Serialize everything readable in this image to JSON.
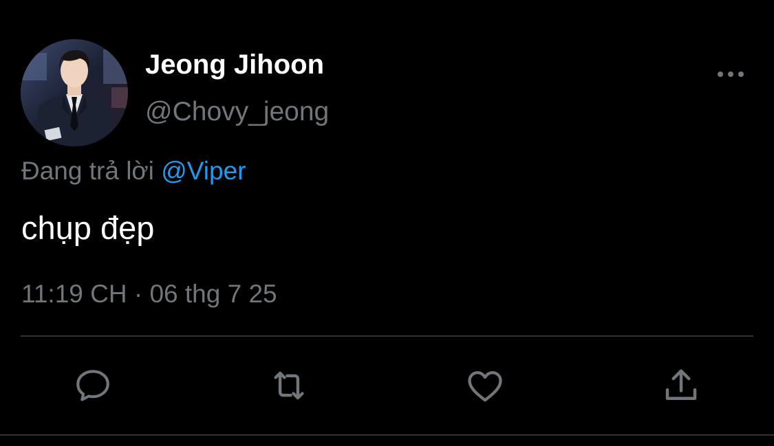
{
  "tweet": {
    "author": {
      "display_name": "Jeong Jihoon",
      "handle": "@Chovy_jeong"
    },
    "reply_context": {
      "prefix": "Đang trả lời",
      "mention": "@Viper"
    },
    "text": "chụp đẹp",
    "timestamp": "11:19 CH · 06 thg 7 25"
  },
  "icons": {
    "more": "more-horizontal-icon",
    "reply": "reply-icon",
    "retweet": "retweet-icon",
    "like": "heart-icon",
    "share": "share-icon"
  },
  "colors": {
    "background": "#000000",
    "primary_text": "#ffffff",
    "secondary_text": "#71767b",
    "link": "#1d9bf0",
    "divider": "#2f3336"
  }
}
